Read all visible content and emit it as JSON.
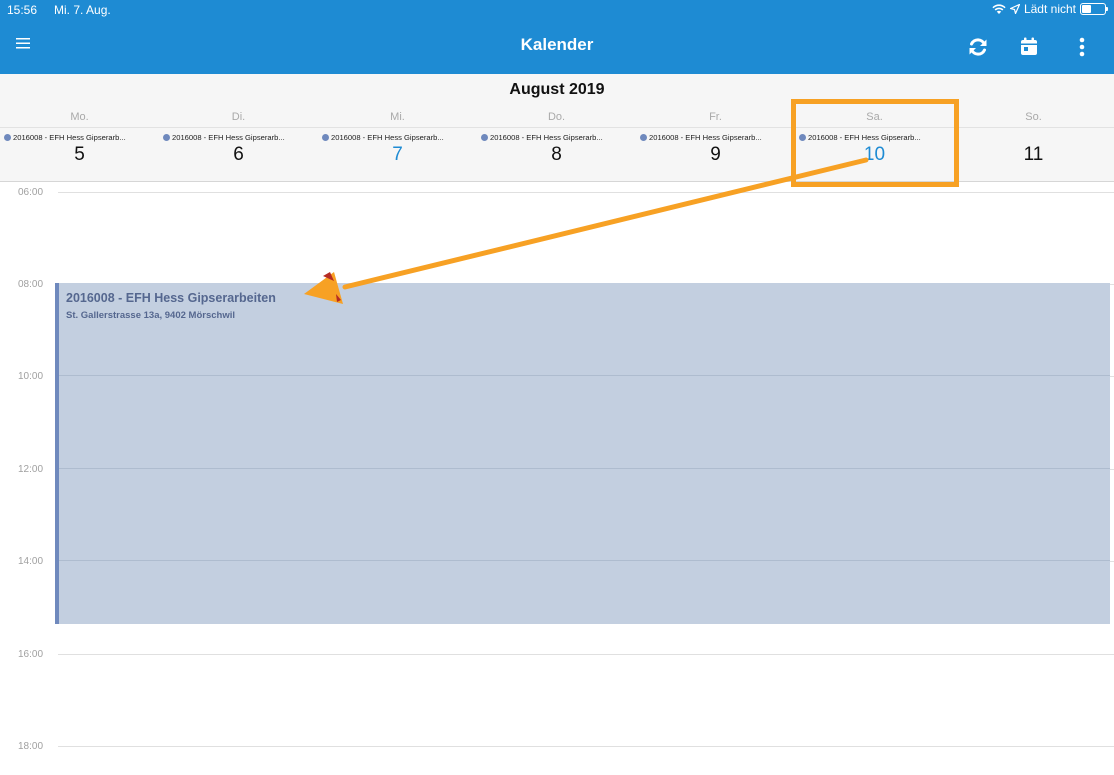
{
  "status_bar": {
    "time": "15:56",
    "date": "Mi. 7. Aug.",
    "charging": "Lädt nicht",
    "icons": [
      "wifi-icon",
      "location-icon",
      "battery-icon"
    ]
  },
  "header": {
    "title": "Kalender",
    "menu_icon": "hamburger-menu-icon",
    "refresh_icon": "refresh-icon",
    "today_icon": "calendar-today-icon",
    "more_icon": "more-vertical-icon",
    "color": "#1e8bd3"
  },
  "week": {
    "month_title": "August 2019",
    "days": [
      {
        "label": "Mo.",
        "number": "5",
        "event": "2016008 - EFH Hess Gipserarb...",
        "today": false
      },
      {
        "label": "Di.",
        "number": "6",
        "event": "2016008 - EFH Hess Gipserarb...",
        "today": false
      },
      {
        "label": "Mi.",
        "number": "7",
        "event": "2016008 - EFH Hess Gipserarb...",
        "today": true
      },
      {
        "label": "Do.",
        "number": "8",
        "event": "2016008 - EFH Hess Gipserarb...",
        "today": false
      },
      {
        "label": "Fr.",
        "number": "9",
        "event": "2016008 - EFH Hess Gipserarb...",
        "today": false
      },
      {
        "label": "Sa.",
        "number": "10",
        "event": "2016008 - EFH Hess Gipserarb...",
        "today": false
      },
      {
        "label": "So.",
        "number": "11",
        "event": "",
        "today": false
      }
    ]
  },
  "timeline": {
    "hours": [
      "06:00",
      "08:00",
      "10:00",
      "12:00",
      "14:00",
      "16:00",
      "18:00"
    ],
    "event": {
      "title": "2016008 - EFH Hess Gipserarbeiten",
      "address": "St. Gallerstrasse 13a, 9402 Mörschwil",
      "color": "#6f89bd",
      "fill": "#c3cfe0"
    }
  },
  "annotation": {
    "color": "#f7a124"
  }
}
